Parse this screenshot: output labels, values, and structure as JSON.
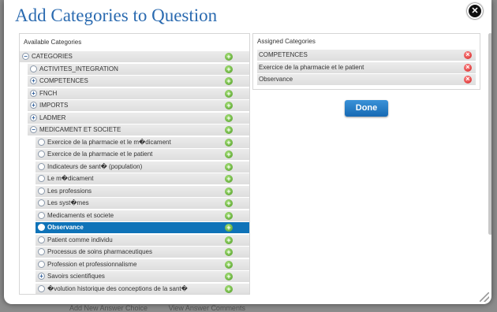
{
  "dialog": {
    "title": "Add Categories to Question",
    "close_icon": "close-icon",
    "done_label": "Done"
  },
  "backdrop": {
    "links": [
      "Add New Answer Choice",
      "View Answer Comments"
    ]
  },
  "available": {
    "header": "Available Categories",
    "root": "CATEGORIES",
    "items": [
      {
        "label": "ACTIVITES_INTEGRATION",
        "level": 1,
        "control": "empty"
      },
      {
        "label": "COMPETENCES",
        "level": 1,
        "control": "plus"
      },
      {
        "label": "FNCH",
        "level": 0,
        "control": "plus"
      },
      {
        "label": "IMPORTS",
        "level": 0,
        "control": "plus"
      },
      {
        "label": "LADMER",
        "level": 0,
        "control": "plus"
      },
      {
        "label": "MEDICAMENT ET SOCIETE",
        "level": 1,
        "control": "minus"
      },
      {
        "label": "Exercice de la pharmacie et le m�dicament",
        "level": 2,
        "control": "empty"
      },
      {
        "label": "Exercice de la pharmacie et le patient",
        "level": 2,
        "control": "empty"
      },
      {
        "label": "Indicateurs de sant� (population)",
        "level": 2,
        "control": "empty"
      },
      {
        "label": "Le m�dicament",
        "level": 2,
        "control": "empty"
      },
      {
        "label": "Les professions",
        "level": 2,
        "control": "empty"
      },
      {
        "label": "Les syst�mes",
        "level": 2,
        "control": "empty"
      },
      {
        "label": "Medicaments et societe",
        "level": 2,
        "control": "empty"
      },
      {
        "label": "Observance",
        "level": 2,
        "control": "empty",
        "selected": true
      },
      {
        "label": "Patient comme individu",
        "level": 2,
        "control": "empty"
      },
      {
        "label": "Processus de soins pharmaceutiques",
        "level": 2,
        "control": "empty"
      },
      {
        "label": "Profession et professionnalisme",
        "level": 2,
        "control": "empty"
      },
      {
        "label": "Savoirs scientifiques",
        "level": 2,
        "control": "plus"
      },
      {
        "label": "�volution historique des conceptions de la sant�",
        "level": 2,
        "control": "empty"
      }
    ]
  },
  "assigned": {
    "header": "Assigned Categories",
    "items": [
      "COMPETENCES",
      "Exercice de la pharmacie et le patient",
      "Observance"
    ]
  },
  "colors": {
    "title": "#2a6ab0",
    "selected_row": "#0f73b8",
    "add_icon": "#4c9a22",
    "remove_icon": "#d31e1e",
    "done_button": "#1769b3"
  }
}
